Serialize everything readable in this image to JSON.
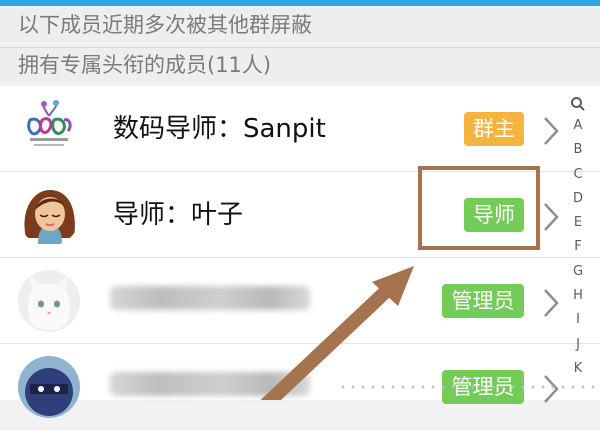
{
  "section_headers": {
    "shielded": "以下成员近期多次被其他群屏蔽",
    "titled": "拥有专属头衔的成员(11人)"
  },
  "members": [
    {
      "name": "数码导师：Sanpit",
      "badge": "群主",
      "badge_color": "#f5b43d",
      "avatar_logo_text": "三叶草 Family"
    },
    {
      "name": "导师：叶子",
      "badge": "导师",
      "badge_color": "#74cc58"
    },
    {
      "badge": "管理员",
      "badge_color": "#74cc58"
    },
    {
      "badge": "管理员",
      "badge_color": "#74cc58"
    }
  ],
  "index_bar": {
    "search_icon": "search-icon",
    "letters": [
      "A",
      "B",
      "C",
      "D",
      "E",
      "F",
      "G",
      "H",
      "I",
      "J",
      "K"
    ]
  },
  "colors": {
    "accent_blue": "#2aa7e6",
    "annotation_brown": "#a6734f"
  }
}
